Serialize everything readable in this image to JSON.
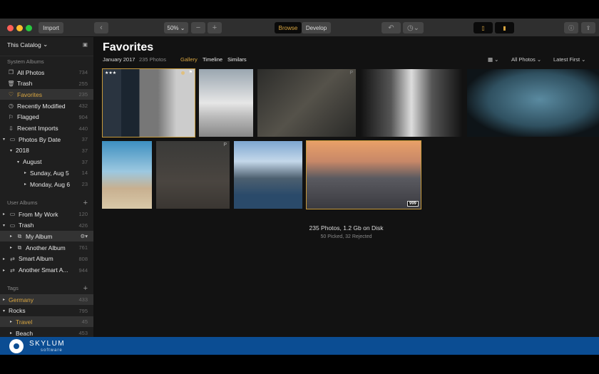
{
  "toolbar": {
    "import": "Import",
    "zoom": "50%",
    "browse": "Browse",
    "develop": "Develop"
  },
  "sidebar": {
    "catalog": "This Catalog",
    "system_albums": "System Albums",
    "system": [
      {
        "label": "All Photos",
        "count": "734",
        "icon": "photos-icon"
      },
      {
        "label": "Trash",
        "count": "255",
        "icon": "trash-icon"
      },
      {
        "label": "Favorites",
        "count": "235",
        "icon": "heart-icon"
      },
      {
        "label": "Recently Modified",
        "count": "432",
        "icon": "clock-icon"
      },
      {
        "label": "Flagged",
        "count": "904",
        "icon": "flag-icon"
      },
      {
        "label": "Recent Imports",
        "count": "440",
        "icon": "import-icon"
      },
      {
        "label": "Photos By Date",
        "count": "37",
        "icon": "calendar-icon"
      },
      {
        "label": "2018",
        "count": "37"
      },
      {
        "label": "August",
        "count": "37"
      },
      {
        "label": "Sunday, Aug 5",
        "count": "14"
      },
      {
        "label": "Monday, Aug 6",
        "count": "23"
      }
    ],
    "user_albums": "User Albums",
    "user": [
      {
        "label": "From My Work",
        "count": "120"
      },
      {
        "label": "Trash",
        "count": "426"
      },
      {
        "label": "My Album",
        "count": ""
      },
      {
        "label": "Another Album",
        "count": "761"
      },
      {
        "label": "Smart Album",
        "count": "808"
      },
      {
        "label": "Another Smart A...",
        "count": "944"
      }
    ],
    "tags_title": "Tags",
    "tags": [
      {
        "label": "Germany",
        "count": "433"
      },
      {
        "label": "Rocks",
        "count": "795"
      },
      {
        "label": "Travel",
        "count": "45"
      },
      {
        "label": "Beach",
        "count": "453"
      }
    ]
  },
  "main": {
    "title": "Favorites",
    "date": "January 2017",
    "photo_count": "235 Photos",
    "tabs": [
      "Gallery",
      "Timeline",
      "Similars"
    ],
    "filter": "All Photos",
    "sort": "Latest First",
    "summary": "235 Photos, 1.2 Gb on Disk",
    "sub": "50 Picked, 32 Rejected",
    "thumb_rating": "★★★",
    "thumb_badge": "999",
    "pick_badge": "P"
  },
  "brand": {
    "name": "SKYLUM",
    "sub": "software"
  },
  "colors": {
    "accent": "#d9a640",
    "brand": "#0b4d93"
  }
}
